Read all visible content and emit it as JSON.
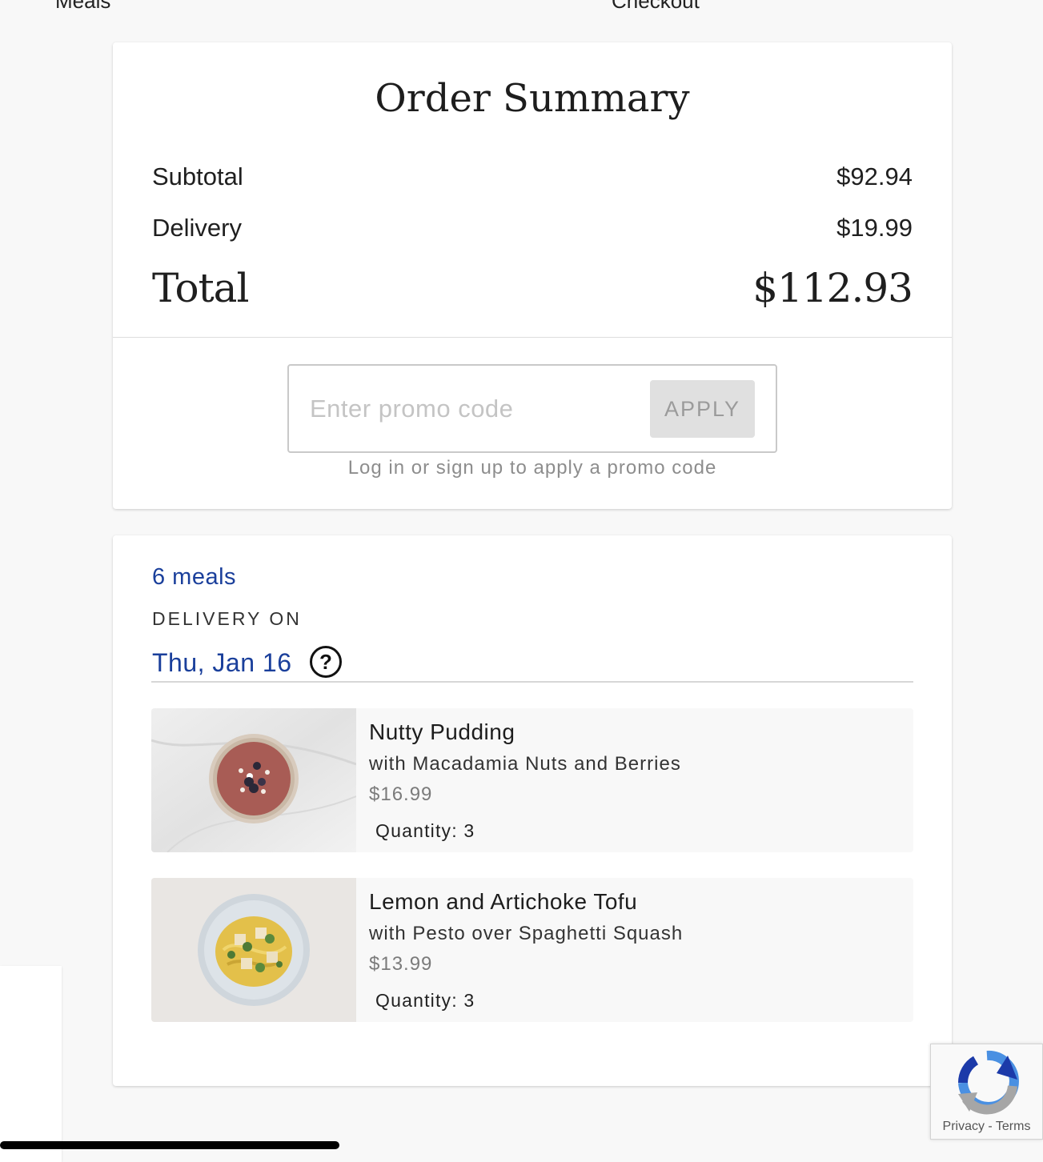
{
  "nav": {
    "step1": "Meals",
    "step2": "Checkout"
  },
  "summary": {
    "title": "Order Summary",
    "subtotal_label": "Subtotal",
    "subtotal_value": "$92.94",
    "delivery_label": "Delivery",
    "delivery_value": "$19.99",
    "total_label": "Total",
    "total_value": "$112.93"
  },
  "promo": {
    "placeholder": "Enter promo code",
    "value": "",
    "apply_label": "APPLY",
    "hint": "Log in or sign up to apply a promo code"
  },
  "order": {
    "meals_count": "6 meals",
    "delivery_on_label": "DELIVERY ON",
    "delivery_date": "Thu, Jan 16",
    "help_icon": "question-circle-icon",
    "items": [
      {
        "name": "Nutty Pudding",
        "description": "with Macadamia Nuts and Berries",
        "price": "$16.99",
        "quantity": "Quantity: 3"
      },
      {
        "name": "Lemon and Artichoke Tofu",
        "description": "with Pesto over Spaghetti Squash",
        "price": "$13.99",
        "quantity": "Quantity: 3"
      }
    ]
  },
  "recaptcha": {
    "privacy": "Privacy",
    "separator": " - ",
    "terms": "Terms"
  },
  "colors": {
    "accent_blue": "#1a3f9b",
    "card_bg": "#ffffff",
    "page_bg": "#f8f8f8"
  }
}
